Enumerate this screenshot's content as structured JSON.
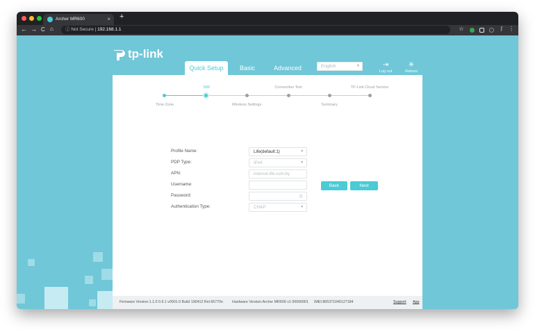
{
  "browser": {
    "tab_title": "Archer MR600",
    "tab_close": "×",
    "new_tab": "+",
    "back": "←",
    "forward": "→",
    "reload": "C",
    "home": "⌂",
    "security_icon": "ⓘ",
    "security_label": "Not Secure",
    "url": "192.168.1.1",
    "ext_star": "☆",
    "ext_menu": "⋮"
  },
  "header": {
    "logo_text": "tp-link",
    "tabs": [
      {
        "label": "Quick Setup",
        "active": true
      },
      {
        "label": "Basic",
        "active": false
      },
      {
        "label": "Advanced",
        "active": false
      }
    ],
    "language": "English",
    "caret": "▾",
    "logout_label": "Log out",
    "reboot_label": "Reboot"
  },
  "steps": {
    "items": [
      {
        "label": "Time Zone",
        "state": "done"
      },
      {
        "label": "SIM",
        "state": "current"
      },
      {
        "label": "Wireless Settings",
        "state": "todo"
      },
      {
        "label": "Connection Test",
        "state": "todo"
      },
      {
        "label": "Summary",
        "state": "todo"
      },
      {
        "label": "TP-Link Cloud Service",
        "state": "todo"
      }
    ]
  },
  "form": {
    "profile_name": {
      "label": "Profile Name:",
      "value": "Life(default:1)"
    },
    "pdp_type": {
      "label": "PDP Type:",
      "value": "IPv4"
    },
    "apn": {
      "label": "APN:",
      "value": "internet.life.com.by"
    },
    "username": {
      "label": "Username:",
      "value": ""
    },
    "password": {
      "label": "Password:",
      "value": ""
    },
    "auth_type": {
      "label": "Authentication Type:",
      "value": "CHAP"
    },
    "eye_icon": "◎"
  },
  "actions": {
    "back_label": "Back",
    "next_label": "Next"
  },
  "footer": {
    "firmware": "Firmware Version:1.1.0 0.9.1 v0001.0 Build 190412 Rel.66770n",
    "hardware": "Hardware Version:Archer MR600 v1 00000001",
    "imei": "IMEI:865371040127184",
    "support": "Support",
    "app": "App"
  },
  "colors": {
    "accent": "#4acbd6",
    "background": "#6fc7d8"
  }
}
